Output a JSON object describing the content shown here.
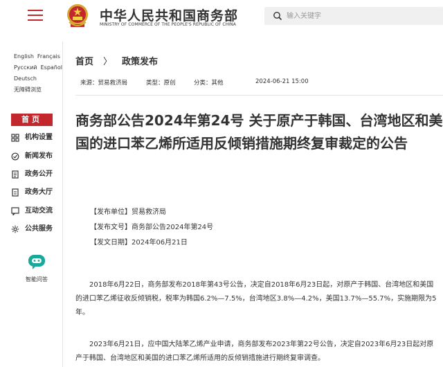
{
  "header": {
    "title": "中华人民共和国商务部",
    "subtitle": "MINISTRY OF COMMERCE OF THE PEOPLE'S REPUBLIC OF CHINA",
    "search_placeholder": "输入关键字"
  },
  "sidebar": {
    "languages": [
      [
        "English",
        "Français"
      ],
      [
        "Русский",
        "Español"
      ],
      [
        "Deutsch"
      ],
      [
        "无障碍浏览"
      ]
    ],
    "home_label": "首页",
    "items": [
      {
        "label": "机构设置",
        "icon": "org-icon"
      },
      {
        "label": "新闻发布",
        "icon": "news-icon"
      },
      {
        "label": "政务公开",
        "icon": "public-icon"
      },
      {
        "label": "政务大厅",
        "icon": "hall-icon"
      },
      {
        "label": "互动交流",
        "icon": "chat-icon"
      },
      {
        "label": "公共服务",
        "icon": "service-icon"
      }
    ],
    "assistant_label": "智能问答"
  },
  "breadcrumb": {
    "home": "首页",
    "current": "政策发布"
  },
  "meta": {
    "source": "来源：贸易救济局",
    "type": "类型：原创",
    "category": "分类：其他",
    "date": "2024-06-21 15:00"
  },
  "article": {
    "title": "商务部公告2024年第24号 关于原产于韩国、台湾地区和美国的进口苯乙烯所适用反倾销措施期终复审裁定的公告",
    "info": [
      "【发布单位】贸易救济局",
      "【发布文号】商务部公告2024年第24号",
      "【发文日期】2024年06月21日"
    ],
    "paragraphs": [
      "2018年6月22日，商务部发布2018年第43号公告，决定自2018年6月23日起，对原产于韩国、台湾地区和美国的进口苯乙烯征收反倾销税，税率为韩国6.2%—7.5%，台湾地区3.8%—4.2%，美国13.7%—55.7%，实施期限为5年。",
      "2023年6月21日，应中国大陆苯乙烯产业申请，商务部发布2023年第22号公告，决定自2023年6月23日起对原产于韩国、台湾地区和美国的进口苯乙烯所适用的反倾销措施进行期终复审调查。"
    ]
  },
  "colors": {
    "accent": "#c1272d",
    "assistant": "#1aa89a"
  }
}
